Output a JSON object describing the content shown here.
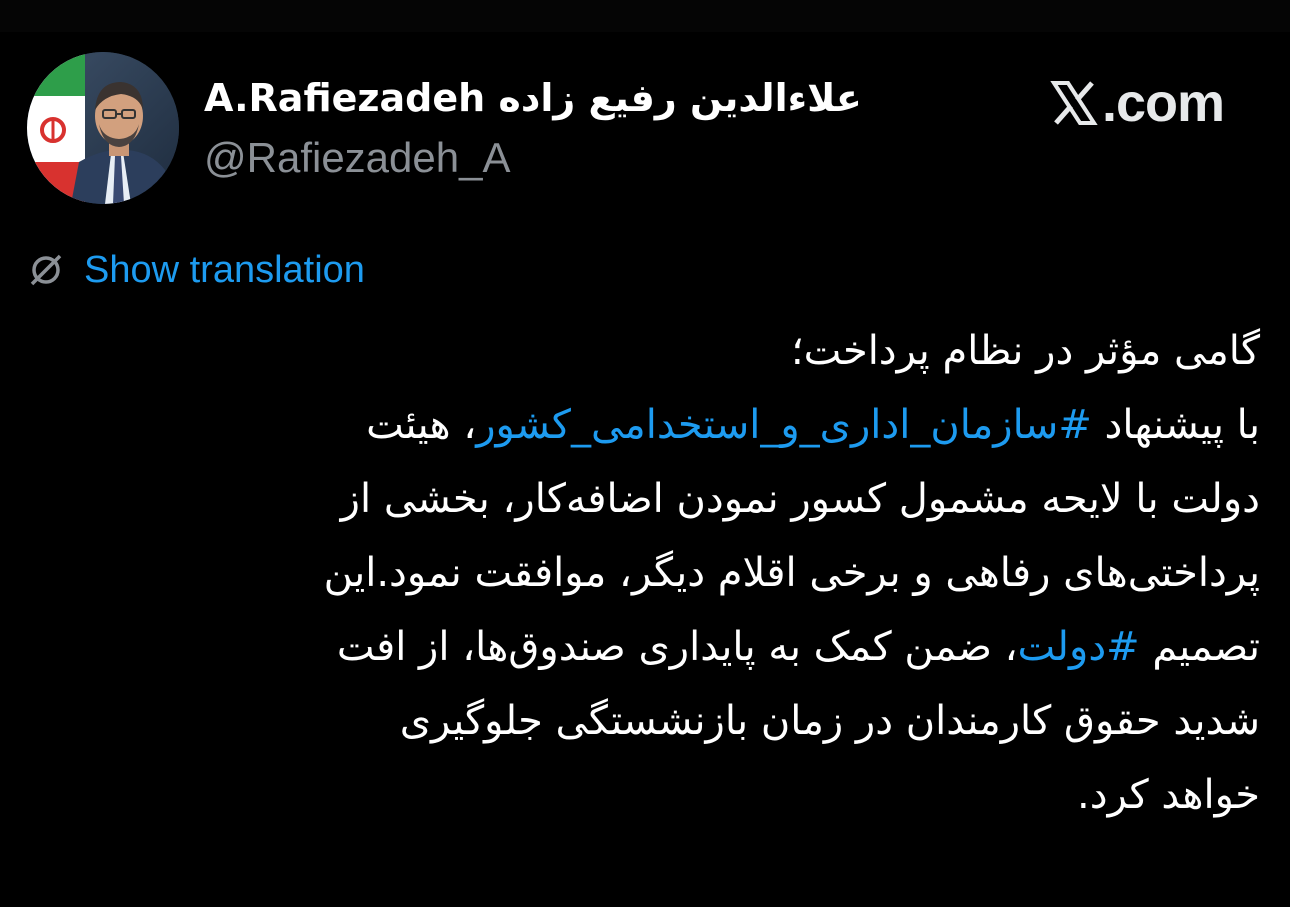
{
  "author": {
    "display_name": "A.Rafiezadeh علاءالدین رفیع زاده",
    "handle": "@Rafiezadeh_A"
  },
  "brand": {
    "name": ".com",
    "icon": "x-logo-icon"
  },
  "translate": {
    "label": "Show translation",
    "icon": "globe-icon"
  },
  "tweet": {
    "line_1": "گامی مؤثر در نظام پرداخت؛",
    "line_2_pre": "با پیشنهاد ",
    "line_2_tag": "#سازمان_اداری_و_استخدامی_کشور",
    "line_2_post": "، هیئت",
    "line_3": "دولت با لایحه مشمول کسور نمودن اضافه‌کار، بخشی از",
    "line_4": "پرداختی‌های رفاهی و برخی اقلام دیگر، موافقت نمود.این",
    "line_5_pre": "تصمیم ",
    "line_5_tag": "#دولت",
    "line_5_post": "، ضمن کمک به پایداری صندوق‌ها، از افت",
    "line_6": "شدید حقوق کارمندان در زمان بازنشستگی جلوگیری",
    "line_7": "خواهد کرد."
  },
  "colors": {
    "background": "#000000",
    "text": "#ffffff",
    "secondary": "#8b9096",
    "link": "#1d9bf0"
  }
}
